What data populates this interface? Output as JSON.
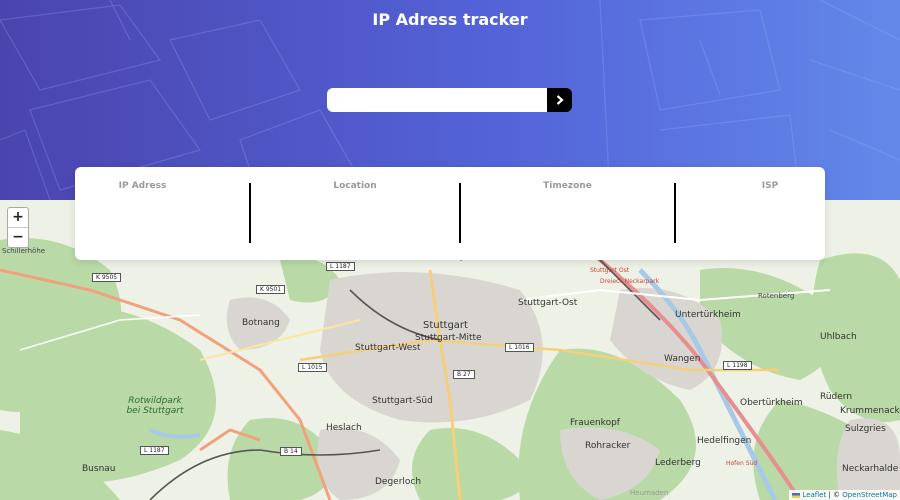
{
  "app": {
    "title": "IP Adress tracker"
  },
  "search": {
    "placeholder": "",
    "value": "",
    "submit_icon": "chevron-right-icon"
  },
  "info": {
    "ip_label": "IP Adress",
    "ip_value": "",
    "location_label": "Location",
    "location_value": "",
    "timezone_label": "Timezone",
    "timezone_value": "",
    "isp_label": "ISP",
    "isp_value": ""
  },
  "map": {
    "zoom_in": "+",
    "zoom_out": "−",
    "labels": {
      "schillerhohe": "Schillerhöhe",
      "botnang": "Botnang",
      "stuttgart": "Stuttgart",
      "stuttgart_mitte": "Stuttgart-Mitte",
      "stuttgart_west": "Stuttgart-West",
      "stuttgart_ost": "Stuttgart-Ost",
      "stuttgart_sud": "Stuttgart-Süd",
      "untertürkheim": "Untertürkheim",
      "wangen": "Wangen",
      "rotenberg": "Rotenberg",
      "uhlbach": "Uhlbach",
      "obertürkheim": "Obertürkheim",
      "rudern": "Rüdern",
      "krummenacker": "Krummenacker",
      "sulzgries": "Sulzgries",
      "hedelfingen": "Hedelfingen",
      "rohracker": "Rohracker",
      "frauenkopf": "Frauenkopf",
      "lederberg": "Lederberg",
      "heslach": "Heslach",
      "degerloch": "Degerloch",
      "neckarhalde": "Neckarhalde",
      "busnau": "Busnau",
      "rotwildpark": "Rotwildpark bei Stuttgart",
      "dreieck": "Dreieck Neckarpark",
      "stuttgart_ost_red": "Stuttgart Ost",
      "hoflen": "Hofen Süd",
      "heumaden": "Heumaden"
    },
    "shields": {
      "k9505": "K 9505",
      "l1187a": "L 1187",
      "k9501": "K 9501",
      "l1015": "L 1015",
      "l1016": "L 1016",
      "b27": "B 27",
      "b14": "B 14",
      "l1187b": "L 1187",
      "l1198": "L 1198"
    }
  },
  "attribution": {
    "leaflet": "Leaflet",
    "sep": " | © ",
    "osm": "OpenStreetMap"
  },
  "colors": {
    "header_start": "#4b44ad",
    "header_end": "#6388ea",
    "button": "#000000"
  }
}
